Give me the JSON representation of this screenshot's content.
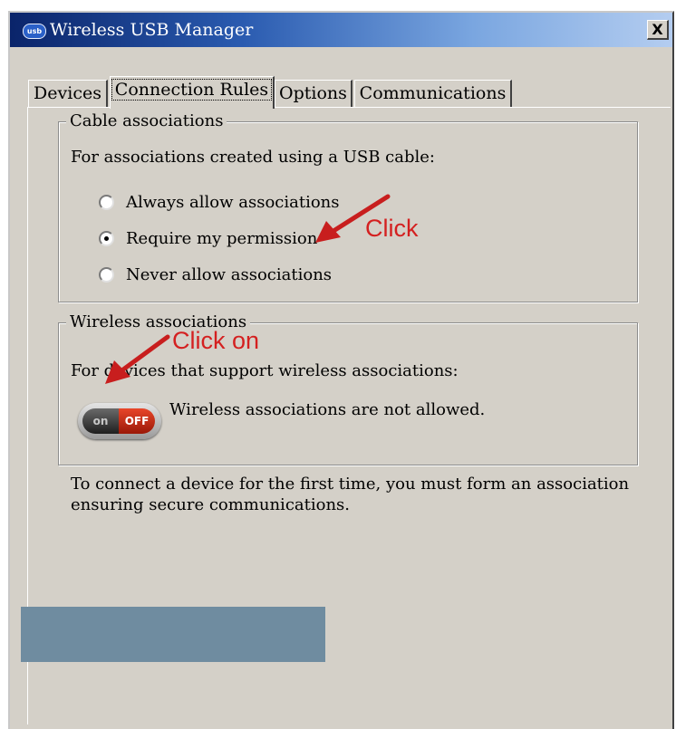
{
  "window": {
    "title": "Wireless USB Manager",
    "icon_text": "usb",
    "close_label": "X",
    "titlebar_color": "#0a246a"
  },
  "tabs": [
    {
      "label": "Devices",
      "active": false
    },
    {
      "label": "Connection Rules",
      "active": true
    },
    {
      "label": "Options",
      "active": false
    },
    {
      "label": "Communications",
      "active": false
    }
  ],
  "cable_group": {
    "legend": "Cable associations",
    "description": "For associations created using a USB cable:",
    "options": [
      {
        "label": "Always allow associations",
        "selected": false
      },
      {
        "label": "Require my permission",
        "selected": true
      },
      {
        "label": "Never allow associations",
        "selected": false
      }
    ]
  },
  "wireless_group": {
    "legend": "Wireless associations",
    "description": "For devices that support wireless associations:",
    "toggle": {
      "on_label": "on",
      "off_label": "OFF",
      "state": "off"
    },
    "status_text": "Wireless associations are not allowed."
  },
  "footer_text": {
    "line1": "To connect a device for the first time, you must form an association",
    "line2": "ensuring secure communications."
  },
  "annotations": {
    "click": "Click",
    "click_on": "Click on",
    "color": "#d42020"
  }
}
